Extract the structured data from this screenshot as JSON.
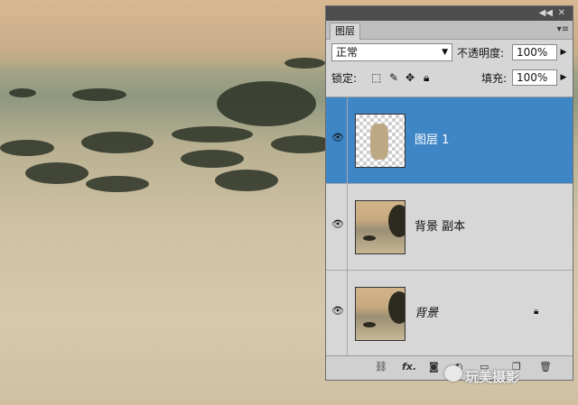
{
  "panel": {
    "tab_label": "图层",
    "blend_mode": "正常",
    "opacity_label": "不透明度:",
    "opacity_value": "100%",
    "lock_label": "锁定:",
    "fill_label": "填充:",
    "fill_value": "100%",
    "icons": {
      "collapse": "double-arrow-icon",
      "close": "close-icon",
      "menu": "panel-menu-icon",
      "visibility": "eye-icon",
      "lock": "lock-icon"
    },
    "layers": [
      {
        "name": "图层 1",
        "selected": true
      },
      {
        "name": "背景 副本",
        "selected": false
      },
      {
        "name": "背景",
        "selected": false,
        "locked": true
      }
    ],
    "bottom_icons": [
      "link-icon",
      "fx-icon",
      "mask-icon",
      "adjustment-icon",
      "group-icon",
      "new-layer-icon",
      "delete-icon"
    ],
    "bottom_labels": {
      "fx": "fx."
    }
  },
  "watermark": "玩美摄影",
  "colors": {
    "selection": "#3f86c7",
    "panel_bg": "#d6d6d6",
    "topbar": "#4d4d4d"
  }
}
